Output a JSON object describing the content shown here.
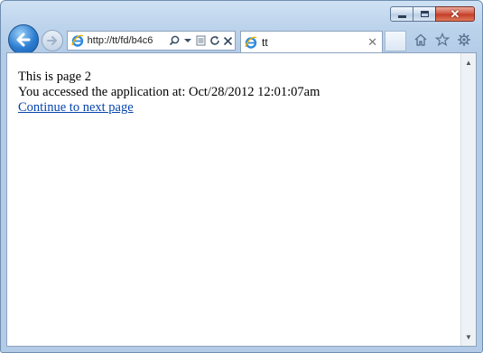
{
  "browser": {
    "address": "http://tt/fd/b4c6",
    "tab_title": "tt",
    "close_glyph": "✕",
    "tab_close_glyph": "✕"
  },
  "icons": {
    "back": "back-arrow-icon",
    "forward": "forward-arrow-icon",
    "site": "ie-logo-icon",
    "search": "search-icon",
    "dropdown": "chevron-down-icon",
    "compat": "compatibility-view-icon",
    "refresh": "refresh-icon",
    "stop": "stop-icon",
    "home": "home-icon",
    "favorites": "star-icon",
    "tools": "gear-icon"
  },
  "page": {
    "line1": "This is page 2",
    "line2": "You accessed the application at: Oct/28/2012 12:01:07am",
    "link": "Continue to next page"
  },
  "colors": {
    "link": "#0645ad",
    "chrome": "#bcd3ec",
    "back_button": "#2a7bd1",
    "close_button": "#c23a24"
  }
}
